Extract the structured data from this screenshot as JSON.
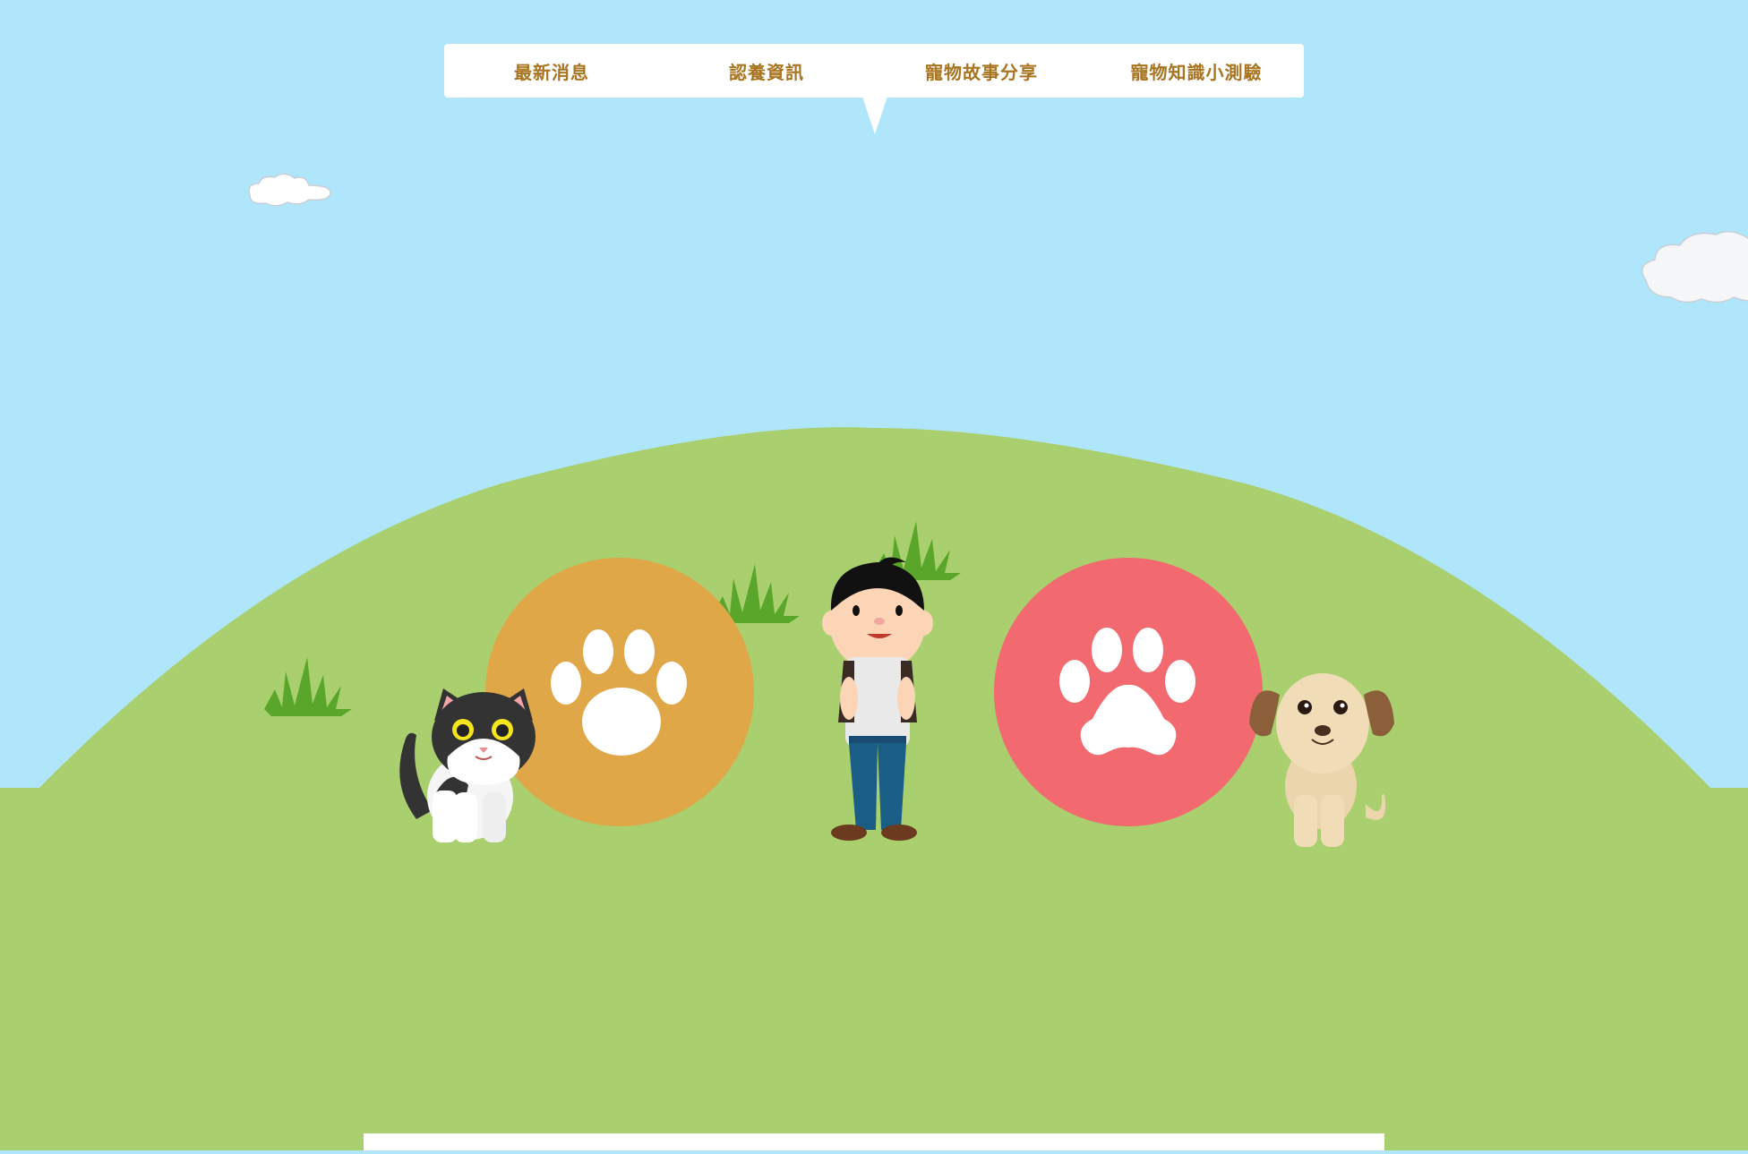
{
  "nav": {
    "items": [
      {
        "label": "最新消息"
      },
      {
        "label": "認養資訊"
      },
      {
        "label": "寵物故事分享"
      },
      {
        "label": "寵物知識小測驗"
      }
    ]
  },
  "colors": {
    "sky": "#afe6fc",
    "grass": "#a9cf6e",
    "nav_text": "#a8741f",
    "cat_circle": "#e0a748",
    "dog_circle": "#f26a6f",
    "grass_tuft": "#5aa62a"
  },
  "icons": [
    "paw-icon",
    "cloud-icon",
    "cat-icon",
    "dog-icon",
    "boy-icon",
    "grass-icon"
  ]
}
